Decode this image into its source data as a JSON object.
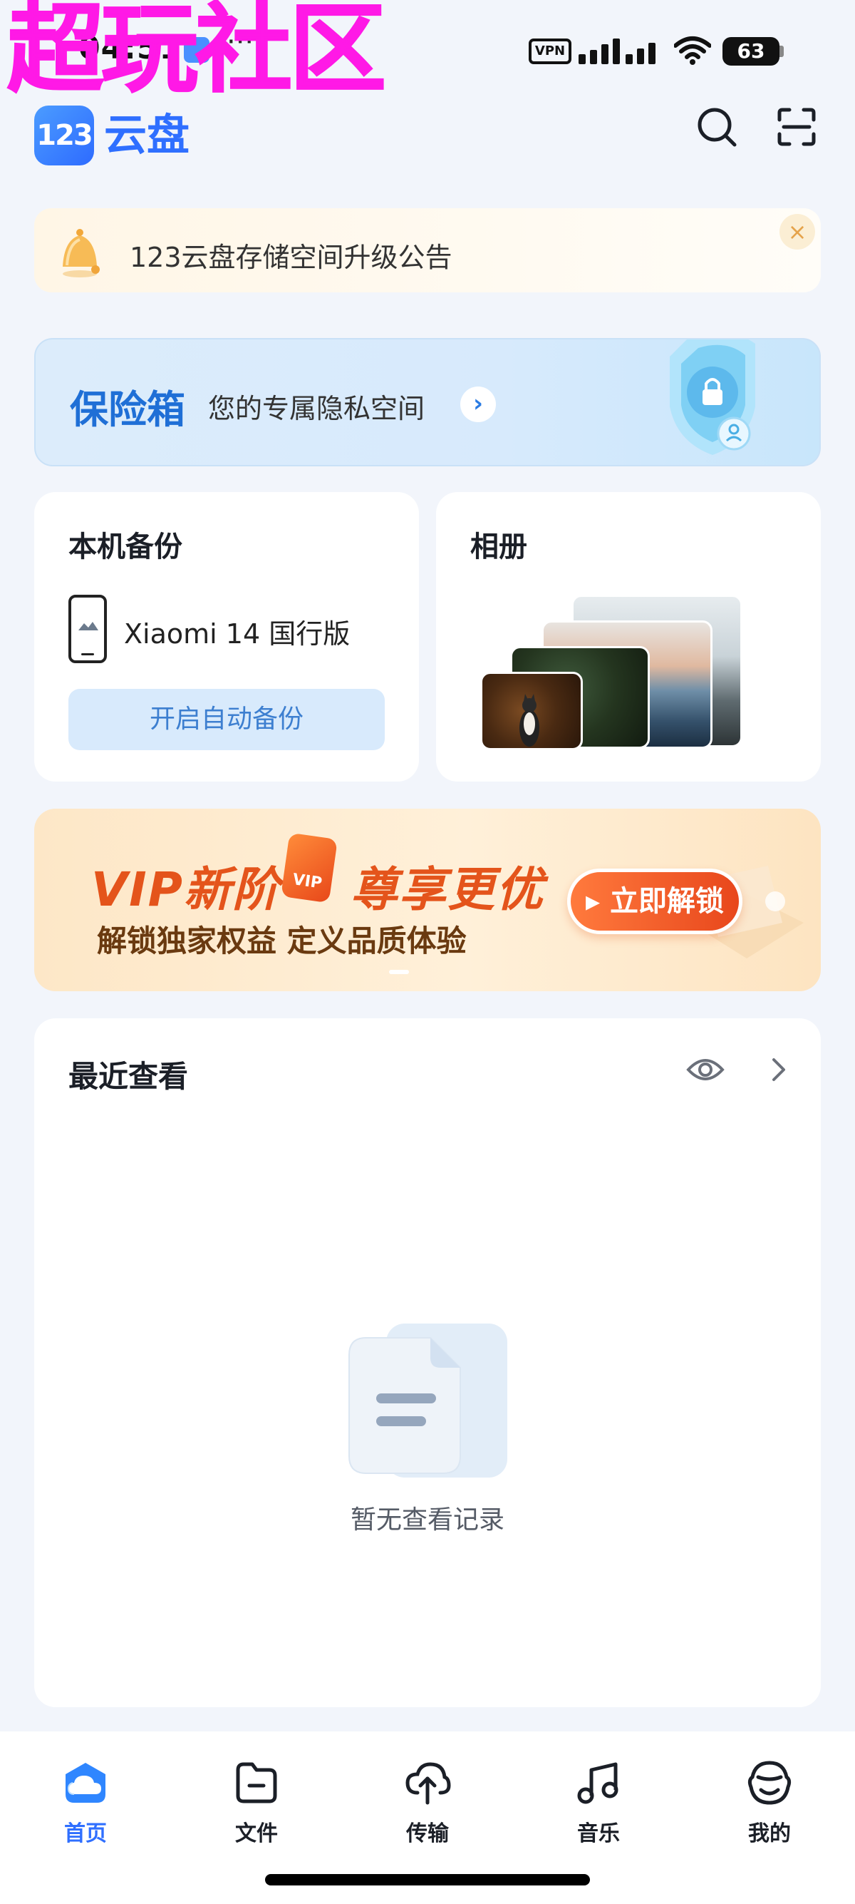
{
  "watermark": "超玩社区",
  "status_bar": {
    "time": "04:51",
    "more_dots": "···",
    "vpn": "VPN",
    "battery": "63"
  },
  "header": {
    "logo_badge": "123",
    "logo_text": "云盘",
    "search_icon": "search-icon",
    "scan_icon": "scan-icon"
  },
  "notice": {
    "text": "123云盘存储空间升级公告",
    "close": "×",
    "icon": "bell-icon"
  },
  "vault": {
    "title": "保险箱",
    "subtitle": "您的专属隐私空间",
    "arrow": "›"
  },
  "backup_card": {
    "title": "本机备份",
    "device": "Xiaomi 14 国行版",
    "button": "开启自动备份"
  },
  "album_card": {
    "title": "相册"
  },
  "vip_banner": {
    "title_left": "VIP新阶",
    "badge": "VIP",
    "title_right": "尊享更优",
    "subtitle": "解锁独家权益  定义品质体验",
    "button": "▸ 立即解锁",
    "accent": "#e4541b"
  },
  "recent": {
    "title": "最近查看",
    "empty_text": "暂无查看记录"
  },
  "bottom_nav": {
    "items": [
      {
        "label": "首页",
        "icon": "cloud-home-icon",
        "active": true
      },
      {
        "label": "文件",
        "icon": "folder-icon",
        "active": false
      },
      {
        "label": "传输",
        "icon": "cloud-transfer-icon",
        "active": false
      },
      {
        "label": "音乐",
        "icon": "music-note-icon",
        "active": false
      },
      {
        "label": "我的",
        "icon": "profile-icon",
        "active": false
      }
    ]
  },
  "colors": {
    "brand": "#2f6fff",
    "background": "#f2f5fb"
  }
}
